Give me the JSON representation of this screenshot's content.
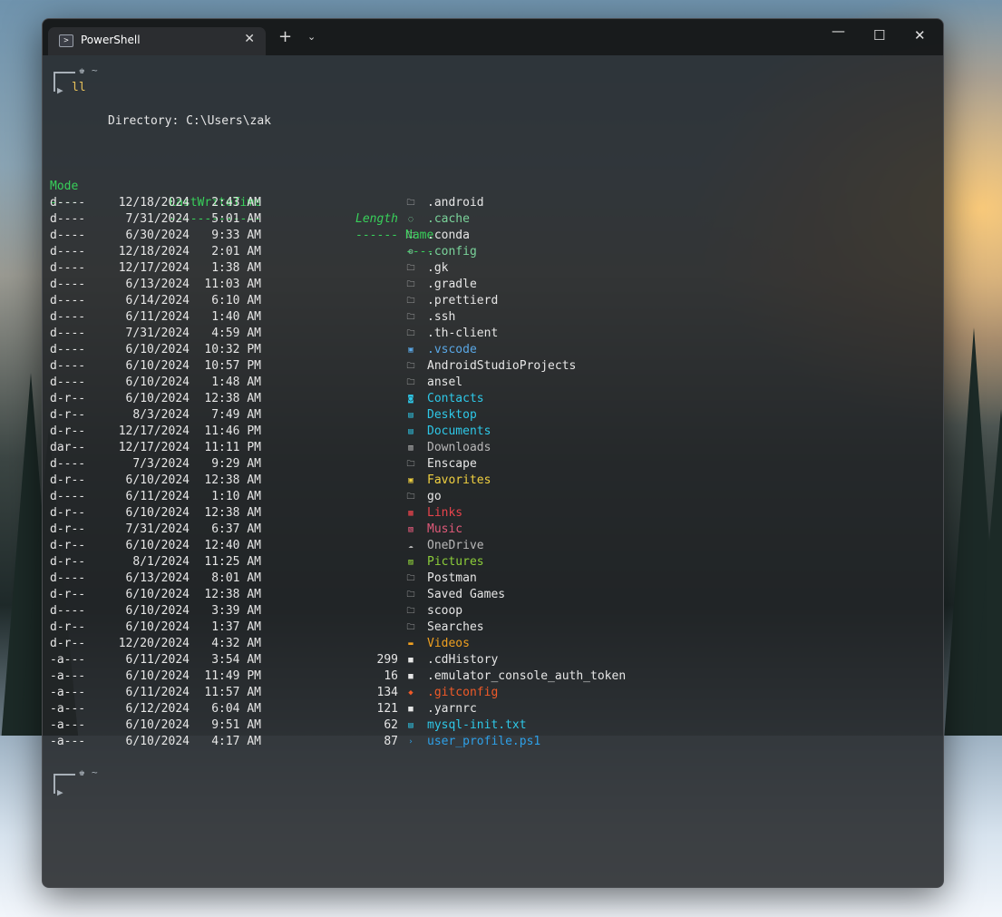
{
  "window": {
    "tab_title": "PowerShell",
    "tab_icon": "powershell-icon",
    "new_tab_label": "+",
    "dropdown_icon": "chevron-down-icon",
    "minimize_label": "—",
    "maximize_label": "☐",
    "close_label": "✕",
    "tab_close_label": "✕"
  },
  "prompt": {
    "path": "~",
    "command": "ll",
    "crown_glyph": "♚"
  },
  "listing": {
    "directory_line": "Directory: C:\\Users\\zak",
    "headers": {
      "mode": "Mode",
      "time": "LastWriteTime",
      "length": "Length",
      "name": "Name"
    },
    "dashes": {
      "mode": "----",
      "time": "-------------",
      "length": "------",
      "name": "----"
    },
    "rows": [
      {
        "mode": "d----",
        "date": "12/18/2024",
        "time": "2:43 AM",
        "length": "",
        "icon": "🗀",
        "name": ".android",
        "color": "#e6e6e6"
      },
      {
        "mode": "d----",
        "date": "7/31/2024",
        "time": "5:01 AM",
        "length": "",
        "icon": "◌",
        "name": ".cache",
        "color": "#7ad39a"
      },
      {
        "mode": "d----",
        "date": "6/30/2024",
        "time": "9:33 AM",
        "length": "",
        "icon": "🗀",
        "name": ".conda",
        "color": "#e6e6e6"
      },
      {
        "mode": "d----",
        "date": "12/18/2024",
        "time": "2:01 AM",
        "length": "",
        "icon": "⚙",
        "name": ".config",
        "color": "#7ad39a"
      },
      {
        "mode": "d----",
        "date": "12/17/2024",
        "time": "1:38 AM",
        "length": "",
        "icon": "🗀",
        "name": ".gk",
        "color": "#e6e6e6"
      },
      {
        "mode": "d----",
        "date": "6/13/2024",
        "time": "11:03 AM",
        "length": "",
        "icon": "🗀",
        "name": ".gradle",
        "color": "#e6e6e6"
      },
      {
        "mode": "d----",
        "date": "6/14/2024",
        "time": "6:10 AM",
        "length": "",
        "icon": "🗀",
        "name": ".prettierd",
        "color": "#e6e6e6"
      },
      {
        "mode": "d----",
        "date": "6/11/2024",
        "time": "1:40 AM",
        "length": "",
        "icon": "🗀",
        "name": ".ssh",
        "color": "#e6e6e6"
      },
      {
        "mode": "d----",
        "date": "7/31/2024",
        "time": "4:59 AM",
        "length": "",
        "icon": "🗀",
        "name": ".th-client",
        "color": "#e6e6e6"
      },
      {
        "mode": "d----",
        "date": "6/10/2024",
        "time": "10:32 PM",
        "length": "",
        "icon": "▣",
        "name": ".vscode",
        "color": "#5aa7e6"
      },
      {
        "mode": "d----",
        "date": "6/10/2024",
        "time": "10:57 PM",
        "length": "",
        "icon": "🗀",
        "name": "AndroidStudioProjects",
        "color": "#e6e6e6"
      },
      {
        "mode": "d----",
        "date": "6/10/2024",
        "time": "1:48 AM",
        "length": "",
        "icon": "🗀",
        "name": "ansel",
        "color": "#e6e6e6"
      },
      {
        "mode": "d-r--",
        "date": "6/10/2024",
        "time": "12:38 AM",
        "length": "",
        "icon": "◙",
        "name": "Contacts",
        "color": "#2ec8e8"
      },
      {
        "mode": "d-r--",
        "date": "8/3/2024",
        "time": "7:49 AM",
        "length": "",
        "icon": "▤",
        "name": "Desktop",
        "color": "#2ec8e8"
      },
      {
        "mode": "d-r--",
        "date": "12/17/2024",
        "time": "11:46 PM",
        "length": "",
        "icon": "▤",
        "name": "Documents",
        "color": "#2ec8e8"
      },
      {
        "mode": "dar--",
        "date": "12/17/2024",
        "time": "11:11 PM",
        "length": "",
        "icon": "▥",
        "name": "Downloads",
        "color": "#b8b8b8"
      },
      {
        "mode": "d----",
        "date": "7/3/2024",
        "time": "9:29 AM",
        "length": "",
        "icon": "🗀",
        "name": "Enscape",
        "color": "#e6e6e6"
      },
      {
        "mode": "d-r--",
        "date": "6/10/2024",
        "time": "12:38 AM",
        "length": "",
        "icon": "▣",
        "name": "Favorites",
        "color": "#f0d040"
      },
      {
        "mode": "d----",
        "date": "6/11/2024",
        "time": "1:10 AM",
        "length": "",
        "icon": "🗀",
        "name": "go",
        "color": "#e6e6e6"
      },
      {
        "mode": "d-r--",
        "date": "6/10/2024",
        "time": "12:38 AM",
        "length": "",
        "icon": "▦",
        "name": "Links",
        "color": "#e8434c"
      },
      {
        "mode": "d-r--",
        "date": "7/31/2024",
        "time": "6:37 AM",
        "length": "",
        "icon": "▧",
        "name": "Music",
        "color": "#e05a7a"
      },
      {
        "mode": "d-r--",
        "date": "6/10/2024",
        "time": "12:40 AM",
        "length": "",
        "icon": "☁",
        "name": "OneDrive",
        "color": "#b8b8b8"
      },
      {
        "mode": "d-r--",
        "date": "8/1/2024",
        "time": "11:25 AM",
        "length": "",
        "icon": "▨",
        "name": "Pictures",
        "color": "#8ccd3a"
      },
      {
        "mode": "d----",
        "date": "6/13/2024",
        "time": "8:01 AM",
        "length": "",
        "icon": "🗀",
        "name": "Postman",
        "color": "#e6e6e6"
      },
      {
        "mode": "d-r--",
        "date": "6/10/2024",
        "time": "12:38 AM",
        "length": "",
        "icon": "🗀",
        "name": "Saved Games",
        "color": "#e6e6e6"
      },
      {
        "mode": "d----",
        "date": "6/10/2024",
        "time": "3:39 AM",
        "length": "",
        "icon": "🗀",
        "name": "scoop",
        "color": "#e6e6e6"
      },
      {
        "mode": "d-r--",
        "date": "6/10/2024",
        "time": "1:37 AM",
        "length": "",
        "icon": "🗀",
        "name": "Searches",
        "color": "#e6e6e6"
      },
      {
        "mode": "d-r--",
        "date": "12/20/2024",
        "time": "4:32 AM",
        "length": "",
        "icon": "▬",
        "name": "Videos",
        "color": "#f0a020"
      },
      {
        "mode": "-a---",
        "date": "6/11/2024",
        "time": "3:54 AM",
        "length": "299",
        "icon": "■",
        "name": ".cdHistory",
        "color": "#e6e6e6"
      },
      {
        "mode": "-a---",
        "date": "6/10/2024",
        "time": "11:49 PM",
        "length": "16",
        "icon": "■",
        "name": ".emulator_console_auth_token",
        "color": "#e6e6e6"
      },
      {
        "mode": "-a---",
        "date": "6/11/2024",
        "time": "11:57 AM",
        "length": "134",
        "icon": "◆",
        "name": ".gitconfig",
        "color": "#f05a28"
      },
      {
        "mode": "-a---",
        "date": "6/12/2024",
        "time": "6:04 AM",
        "length": "121",
        "icon": "■",
        "name": ".yarnrc",
        "color": "#e6e6e6"
      },
      {
        "mode": "-a---",
        "date": "6/10/2024",
        "time": "9:51 AM",
        "length": "62",
        "icon": "▤",
        "name": "mysql-init.txt",
        "color": "#2ec8e8"
      },
      {
        "mode": "-a---",
        "date": "6/10/2024",
        "time": "4:17 AM",
        "length": "87",
        "icon": "›",
        "name": "user_profile.ps1",
        "color": "#2ea0e8"
      }
    ]
  }
}
